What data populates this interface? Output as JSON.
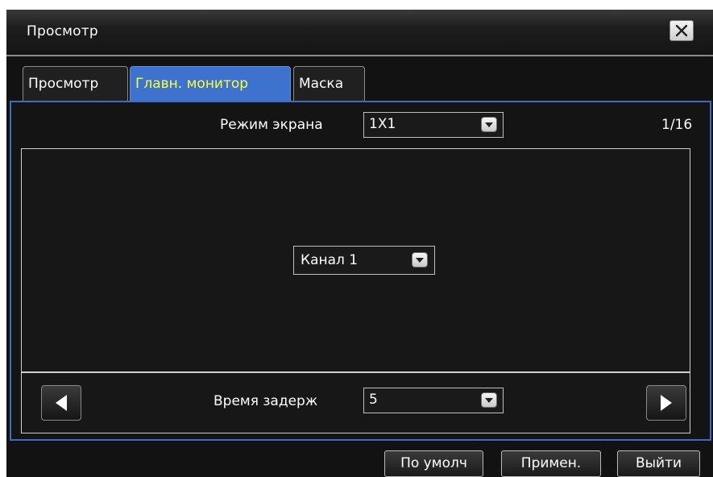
{
  "window": {
    "title": "Просмотр",
    "close_icon": "close-icon"
  },
  "tabs": [
    {
      "label": "Просмотр",
      "active": false
    },
    {
      "label": "Главн. монитор",
      "active": true
    },
    {
      "label": "Маска",
      "active": false
    }
  ],
  "screen_mode": {
    "label": "Режим экрана",
    "value": "1X1"
  },
  "page_indicator": "1/16",
  "channel_select": {
    "value": "Канал 1"
  },
  "delay": {
    "label": "Время задерж",
    "value": "5"
  },
  "buttons": {
    "default": "По умолч",
    "apply": "Примен.",
    "exit": "Выйти"
  },
  "colors": {
    "accent": "#3d72cf",
    "active_tab_text": "#ffff3a",
    "background": "#141414"
  }
}
